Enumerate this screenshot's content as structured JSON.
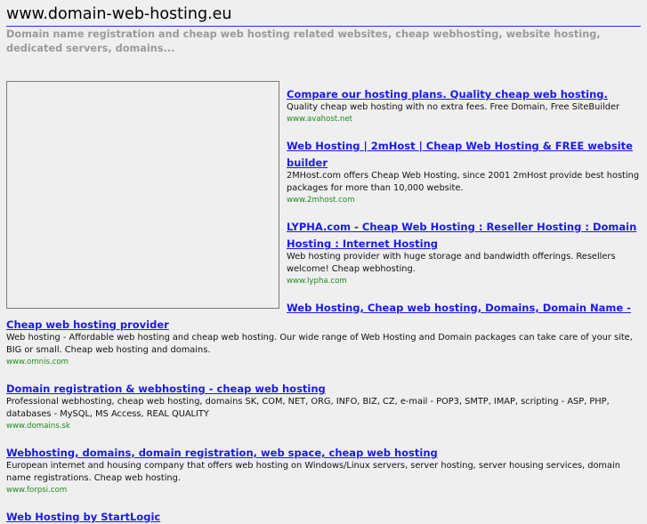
{
  "header": {
    "title": "www.domain-web-hosting.eu",
    "subtitle": "Domain name registration and cheap web hosting related websites, cheap webhosting, website hosting, dedicated servers, domains..."
  },
  "listings": [
    {
      "title": "Compare our hosting plans. Quality cheap web hosting.",
      "desc": "Quality cheap web hosting with no extra fees. Free Domain, Free SiteBuilder",
      "url": "www.avahost.net"
    },
    {
      "title": "Web Hosting | 2mHost | Cheap Web Hosting & FREE website builder",
      "desc": "2MHost.com offers Cheap Web Hosting, since 2001 2mHost provide best hosting packages for more than 10,000 website.",
      "url": "www.2mhost.com"
    },
    {
      "title": "LYPHA.com - Cheap Web Hosting : Reseller Hosting : Domain Hosting : Internet Hosting",
      "desc": "Web hosting provider with huge storage and bandwidth offerings. Resellers welcome! Cheap webhosting.",
      "url": "www.lypha.com"
    },
    {
      "title": "Web Hosting, Cheap web hosting, Domains, Domain Name - Cheap web hosting provider",
      "desc": "Web hosting - Affordable web hosting and cheap web hosting. Our wide range of Web Hosting and Domain packages can take care of your site, BIG or small. Cheap web hosting and domains.",
      "url": "www.omnis.com"
    },
    {
      "title": "Domain registration & webhosting - cheap web hosting",
      "desc": "Professional webhosting, cheap web hosting, domains SK, COM, NET, ORG, INFO, BIZ, CZ, e-mail - POP3, SMTP, IMAP, scripting - ASP, PHP, databases - MySQL, MS Access, REAL QUALITY",
      "url": "www.domains.sk"
    },
    {
      "title": "Webhosting, domains, domain registration, web space, cheap web hosting",
      "desc": "European internet and housing company that offers web hosting on Windows/Linux servers, server hosting, server housing services, domain name registrations. Cheap web hosting.",
      "url": "www.forpsi.com"
    },
    {
      "title": "Web Hosting by StartLogic",
      "desc": "",
      "url": ""
    }
  ]
}
